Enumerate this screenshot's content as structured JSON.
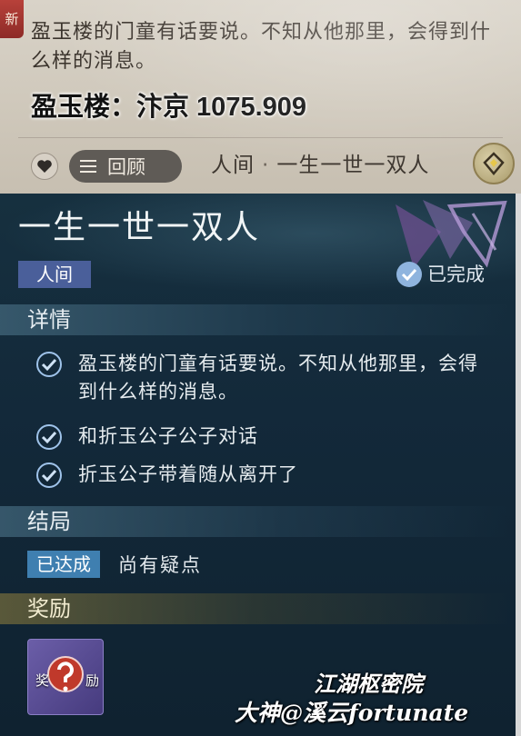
{
  "top": {
    "new_badge": "新",
    "description": "盈玉楼的门童有话要说。不知从他那里，会得到什么样的消息。",
    "location_overlay": "盈玉楼：汴京 1075.909",
    "review_label": "回顾",
    "quest_category": "人间",
    "quest_separator": "·",
    "quest_name": "一生一世一双人"
  },
  "quest": {
    "title": "一生一世一双人",
    "category": "人间",
    "status": "已完成"
  },
  "details": {
    "header": "详情",
    "items": [
      {
        "text": "盈玉楼的门童有话要说。不知从他那里，会得到什么样的消息。",
        "done": true
      },
      {
        "text": "和折玉公子公子对话",
        "done": true
      },
      {
        "text": "折玉公子带着随从离开了",
        "done": true
      }
    ]
  },
  "ending": {
    "header": "结局",
    "badge": "已达成",
    "text": "尚有疑点"
  },
  "rewards": {
    "header": "奖励",
    "item_label_left": "奖",
    "item_label_right": "励"
  },
  "watermark": {
    "line1": "江湖枢密院",
    "line2": "大神@溪云fortunate"
  },
  "colors": {
    "category_tag": "#4a5f9a",
    "ending_badge": "#3f7fb0",
    "check": "#9fc3ea"
  },
  "icons": [
    "new-badge",
    "heart-icon",
    "menu-icon",
    "locate-icon",
    "quest-emblem-icon",
    "check-circle-icon",
    "check-icon",
    "question-mark-icon"
  ]
}
